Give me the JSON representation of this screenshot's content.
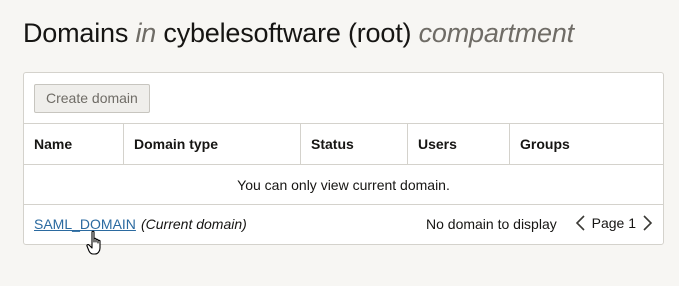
{
  "header": {
    "title_part1": "Domains",
    "title_in": "in",
    "title_tenancy": "cybelesoftware (root)",
    "title_compartment": "compartment"
  },
  "toolbar": {
    "create_label": "Create domain"
  },
  "table": {
    "columns": [
      "Name",
      "Domain type",
      "Status",
      "Users",
      "Groups"
    ],
    "empty_message": "You can only view current domain."
  },
  "footer": {
    "domain_link": "SAML_DOMAIN",
    "current_note": "(Current domain)",
    "no_domain": "No domain to display",
    "page_label": "Page 1"
  },
  "icons": {
    "prev": "chevron-left-icon",
    "next": "chevron-right-icon",
    "cursor": "hand-pointer-cursor-icon"
  },
  "colors": {
    "link": "#2b6aa0",
    "background": "#f7f6f3",
    "border": "#d4d2cc"
  }
}
